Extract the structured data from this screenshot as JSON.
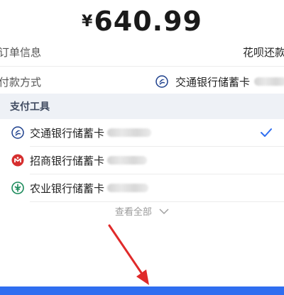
{
  "payment": {
    "currency_symbol": "¥",
    "amount": "640.99"
  },
  "order_info": {
    "label": "订单信息",
    "value": "花呗还款"
  },
  "pay_method": {
    "label": "付款方式",
    "value": "交通银行储蓄卡",
    "icon": "bocom-bank-icon"
  },
  "tools": {
    "header": "支付工具",
    "items": [
      {
        "name": "交通银行储蓄卡",
        "icon": "bocom-bank-icon",
        "selected": true
      },
      {
        "name": "招商银行储蓄卡",
        "icon": "cmb-bank-icon",
        "selected": false
      },
      {
        "name": "农业银行储蓄卡",
        "icon": "abc-bank-icon",
        "selected": false
      }
    ],
    "view_all": "查看全部"
  },
  "colors": {
    "accent": "#2f6ef0",
    "check": "#2f6ef0",
    "arrow": "#e02a2a",
    "bocom": "#1c3f8c",
    "cmb": "#d62e2e",
    "abc": "#1a8a5a"
  }
}
